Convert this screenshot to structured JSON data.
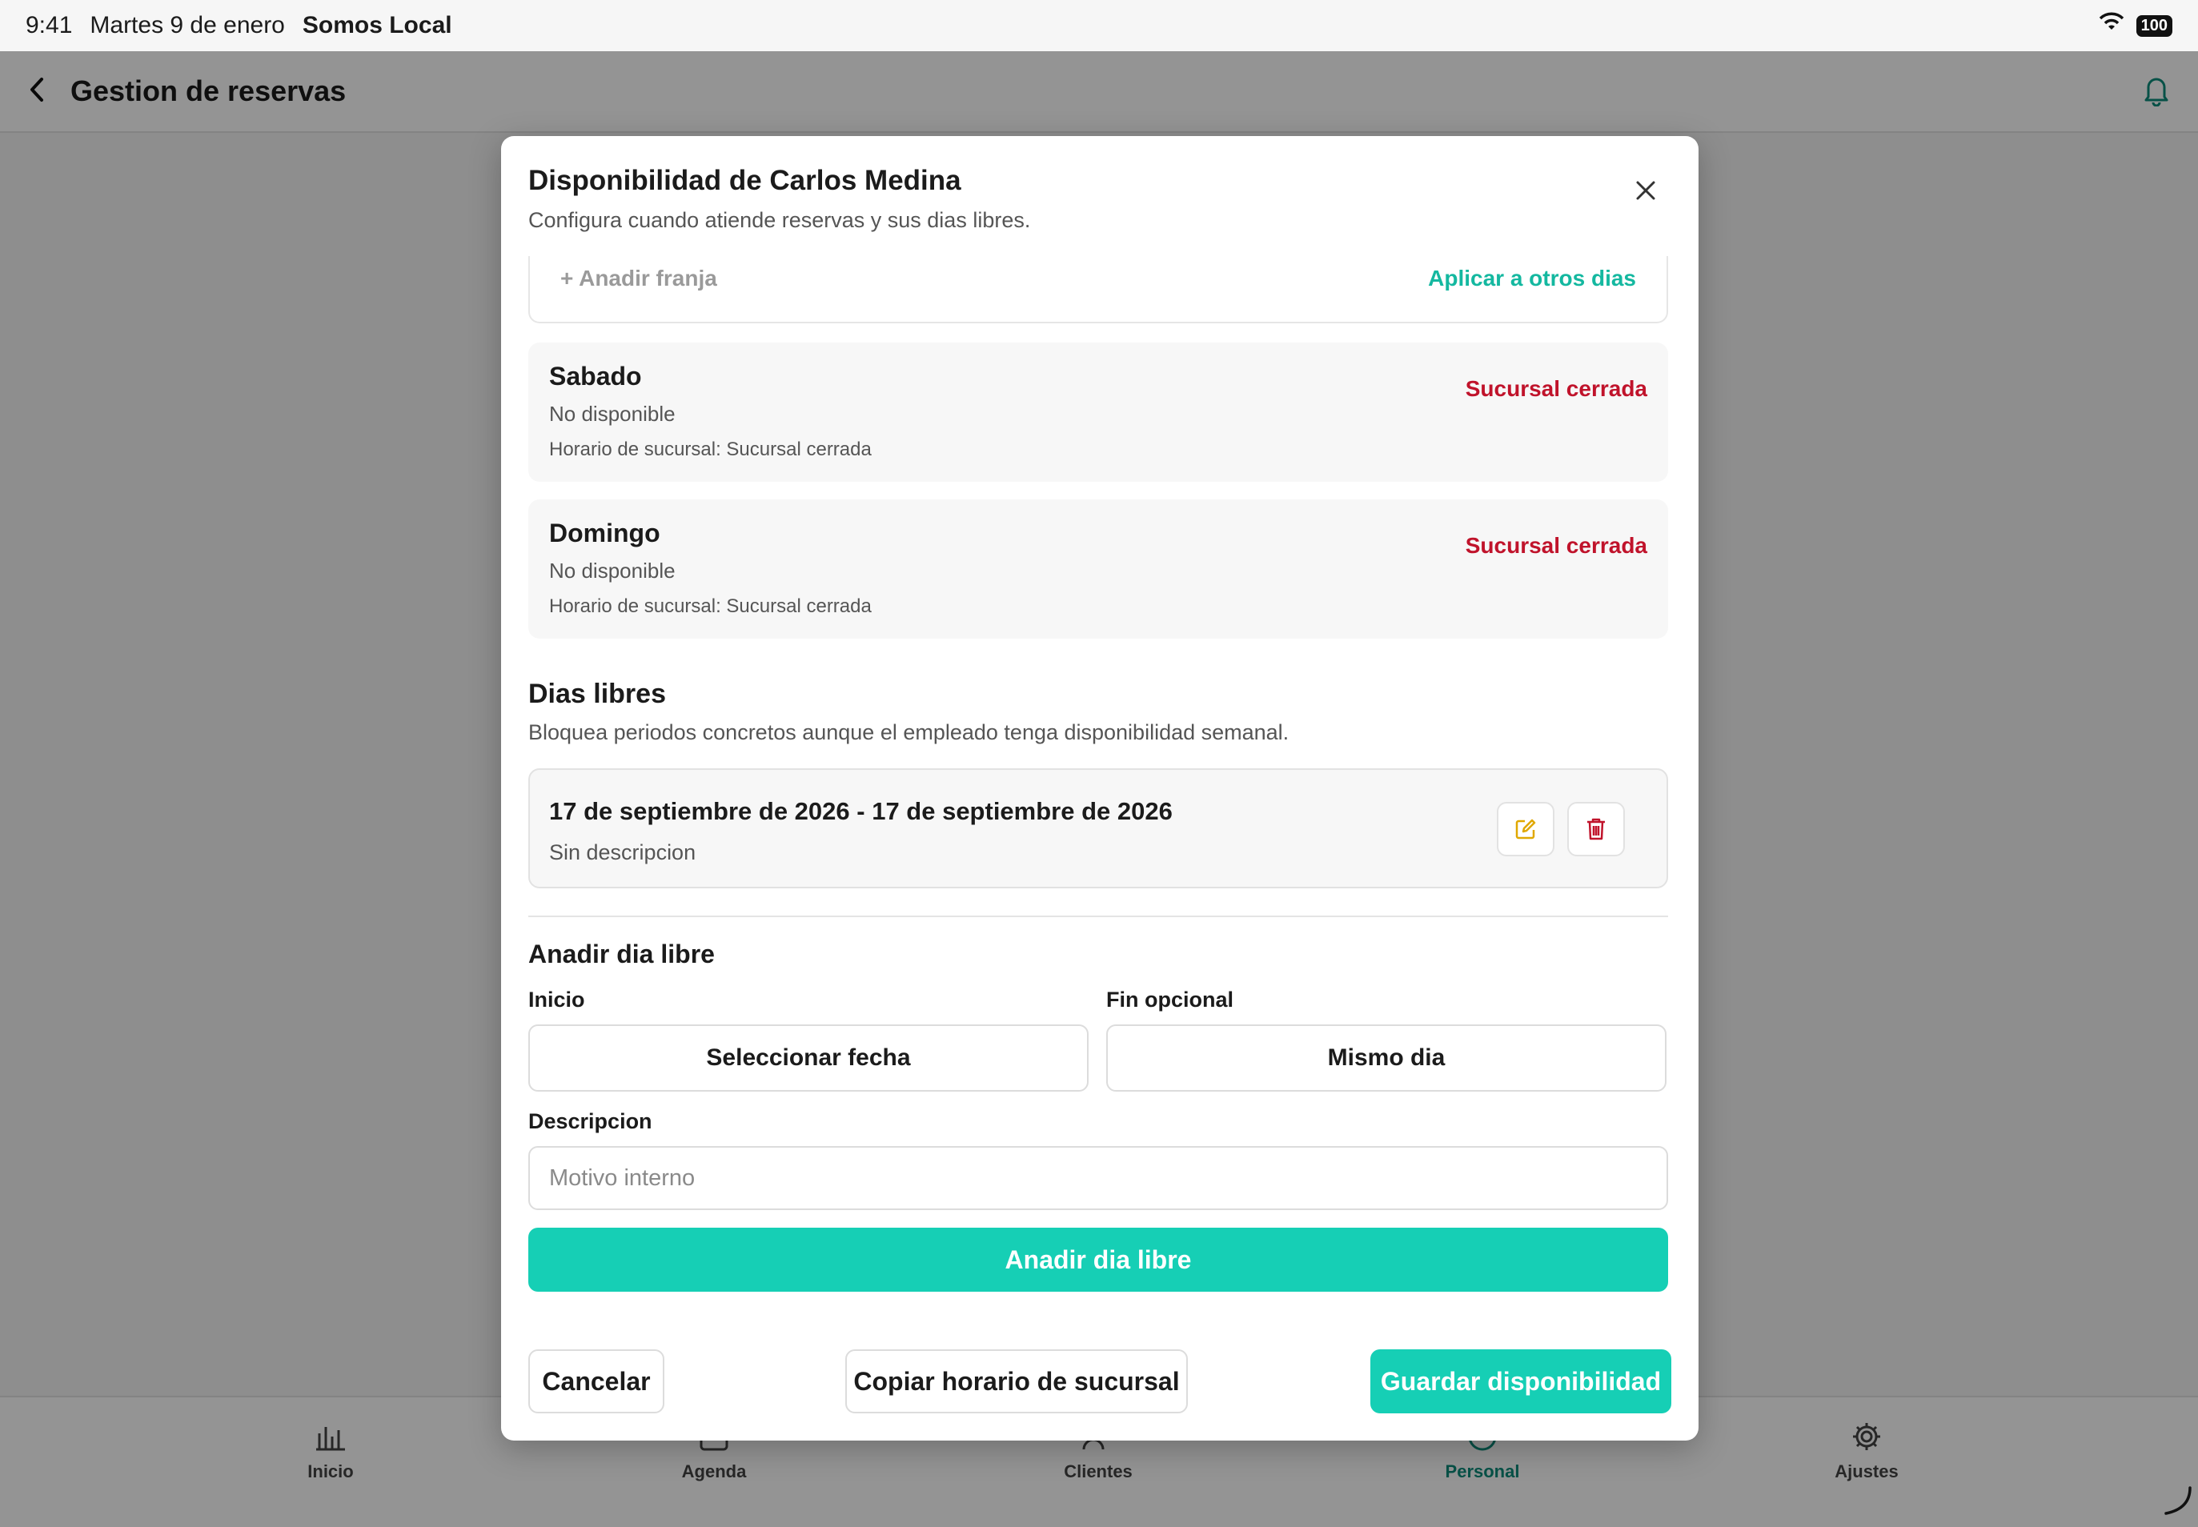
{
  "status_bar": {
    "time": "9:41",
    "date": "Martes 9 de enero",
    "app_name": "Somos Local",
    "battery": "100"
  },
  "header": {
    "title": "Gestion de reservas"
  },
  "tabs": [
    {
      "label": "Inicio",
      "icon": "chart-icon"
    },
    {
      "label": "Agenda",
      "icon": "calendar-icon"
    },
    {
      "label": "Clientes",
      "icon": "users-icon"
    },
    {
      "label": "Personal",
      "icon": "person-icon",
      "active": true
    },
    {
      "label": "Ajustes",
      "icon": "gear-icon"
    }
  ],
  "modal": {
    "title": "Disponibilidad de Carlos Medina",
    "subtitle": "Configura cuando atiende reservas y sus dias libres.",
    "add_slot": "+ Anadir franja",
    "apply_others": "Aplicar a otros dias",
    "days": [
      {
        "name": "Sabado",
        "status": "No disponible",
        "branch_hours": "Horario de sucursal: Sucursal cerrada",
        "badge": "Sucursal cerrada"
      },
      {
        "name": "Domingo",
        "status": "No disponible",
        "branch_hours": "Horario de sucursal: Sucursal cerrada",
        "badge": "Sucursal cerrada"
      }
    ],
    "days_off": {
      "title": "Dias libres",
      "subtitle": "Bloquea periodos concretos aunque el empleado tenga disponibilidad semanal.",
      "items": [
        {
          "range": "17 de septiembre de 2026 - 17 de septiembre de 2026",
          "description": "Sin descripcion"
        }
      ]
    },
    "add_day_off": {
      "title": "Anadir dia libre",
      "start_label": "Inicio",
      "start_value": "Seleccionar fecha",
      "end_label": "Fin opcional",
      "end_value": "Mismo dia",
      "description_label": "Descripcion",
      "description_placeholder": "Motivo interno",
      "button": "Anadir dia libre"
    },
    "footer": {
      "cancel": "Cancelar",
      "copy": "Copiar horario de sucursal",
      "save": "Guardar disponibilidad"
    }
  },
  "colors": {
    "accent": "#16cfb5",
    "accent_text": "#14b8a0",
    "danger": "#c0132b",
    "edit_icon": "#e0a800"
  }
}
